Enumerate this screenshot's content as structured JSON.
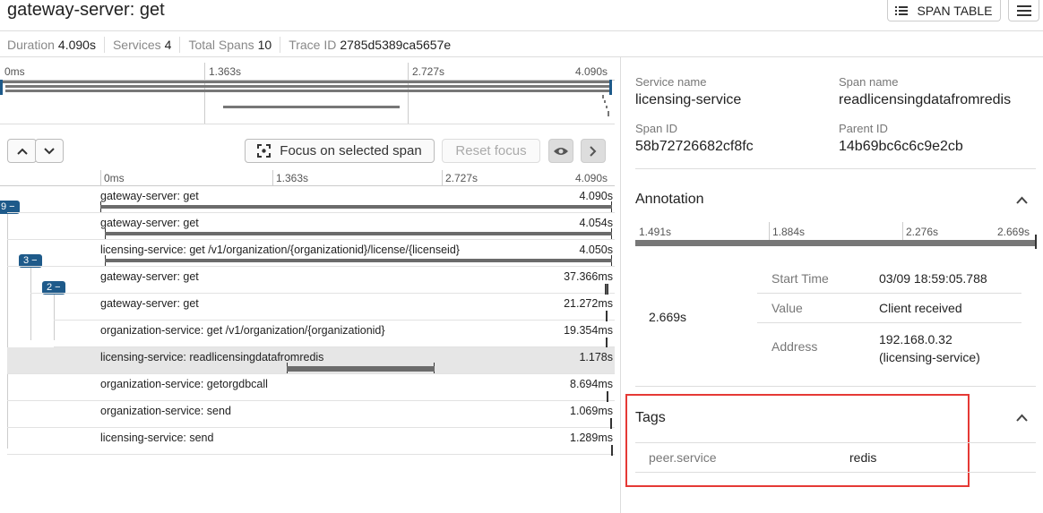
{
  "header": {
    "title": "gateway-server: get",
    "span_table_label": "SPAN TABLE"
  },
  "meta": {
    "duration_label": "Duration",
    "duration": "4.090s",
    "services_label": "Services",
    "services": "4",
    "total_spans_label": "Total Spans",
    "total_spans": "10",
    "trace_id_label": "Trace ID",
    "trace_id": "2785d5389ca5657e"
  },
  "minimap": {
    "ticks": [
      "0ms",
      "1.363s",
      "2.727s",
      "4.090s"
    ]
  },
  "toolbar": {
    "focus_label": "Focus on selected span",
    "reset_label": "Reset focus"
  },
  "timeline": {
    "ticks": [
      "0ms",
      "1.363s",
      "2.727s",
      "4.090s"
    ],
    "badges": [
      "9 −",
      "3 −",
      "2 −"
    ],
    "rows": [
      {
        "label": "gateway-server: get",
        "duration": "4.090s"
      },
      {
        "label": "gateway-server: get",
        "duration": "4.054s"
      },
      {
        "label": "licensing-service: get /v1/organization/{organizationid}/license/{licenseid}",
        "duration": "4.050s"
      },
      {
        "label": "gateway-server: get",
        "duration": "37.366ms"
      },
      {
        "label": "gateway-server: get",
        "duration": "21.272ms"
      },
      {
        "label": "organization-service: get /v1/organization/{organizationid}",
        "duration": "19.354ms"
      },
      {
        "label": "licensing-service: readlicensingdatafromredis",
        "duration": "1.178s"
      },
      {
        "label": "organization-service: getorgdbcall",
        "duration": "8.694ms"
      },
      {
        "label": "organization-service: send",
        "duration": "1.069ms"
      },
      {
        "label": "licensing-service: send",
        "duration": "1.289ms"
      }
    ]
  },
  "details": {
    "service_name_label": "Service name",
    "service_name": "licensing-service",
    "span_name_label": "Span name",
    "span_name": "readlicensingdatafromredis",
    "span_id_label": "Span ID",
    "span_id": "58b72726682cf8fc",
    "parent_id_label": "Parent ID",
    "parent_id": "14b69bc6c6c9e2cb"
  },
  "annotation": {
    "title": "Annotation",
    "ticks": [
      "1.491s",
      "1.884s",
      "2.276s",
      "2.669s"
    ],
    "time": "2.669s",
    "start_time_label": "Start Time",
    "start_time": "03/09 18:59:05.788",
    "value_label": "Value",
    "value": "Client received",
    "address_label": "Address",
    "address": "192.168.0.32 (licensing-service)"
  },
  "tags": {
    "title": "Tags",
    "key": "peer.service",
    "value": "redis"
  },
  "colors": {
    "highlight": "#e53935",
    "badge": "#1e5a8a",
    "selected_row": "#e6e6e6"
  }
}
